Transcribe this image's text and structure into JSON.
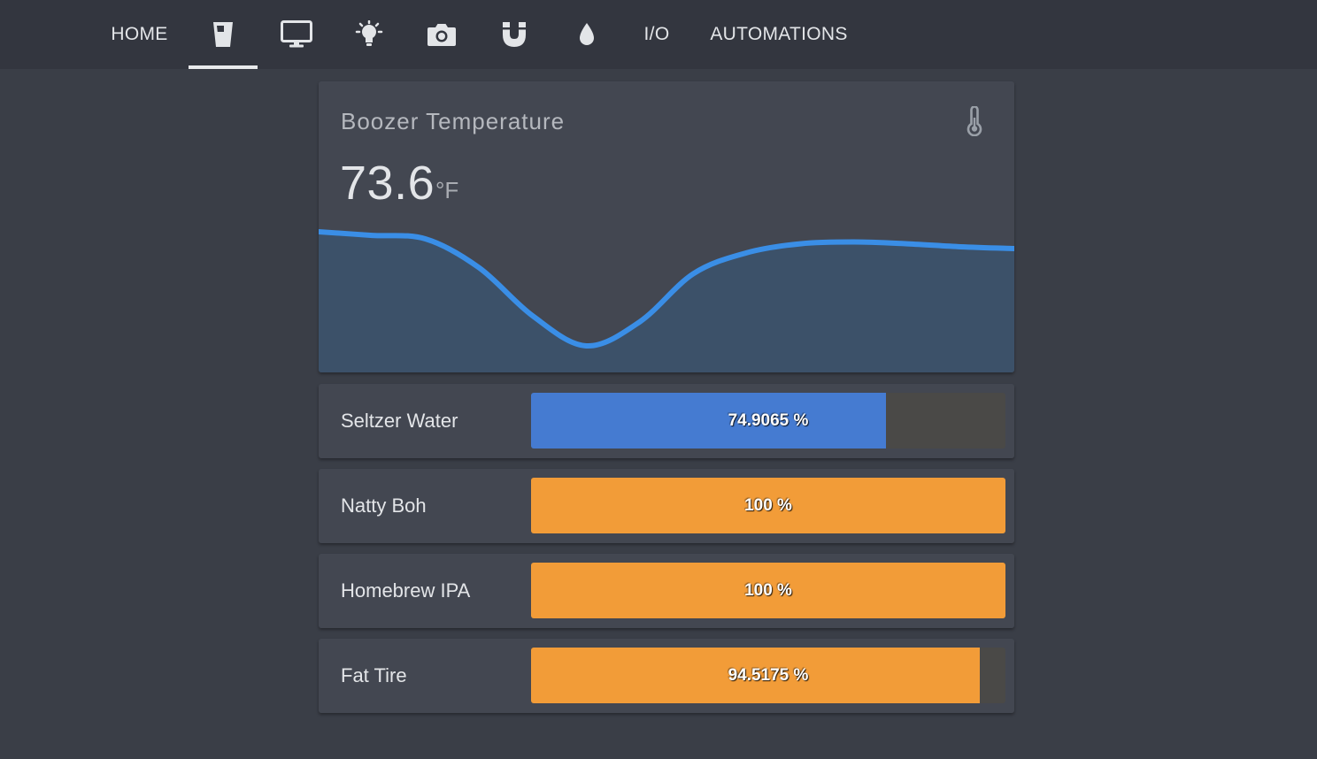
{
  "nav": {
    "tabs": [
      {
        "label": "HOME",
        "icon": null
      },
      {
        "label": "",
        "icon": "glass-icon",
        "active": true
      },
      {
        "label": "",
        "icon": "monitor-icon"
      },
      {
        "label": "",
        "icon": "lightbulb-icon"
      },
      {
        "label": "",
        "icon": "camera-icon"
      },
      {
        "label": "",
        "icon": "magnet-icon"
      },
      {
        "label": "",
        "icon": "water-drop-icon"
      },
      {
        "label": "I/O",
        "icon": null
      },
      {
        "label": "AUTOMATIONS",
        "icon": null
      }
    ]
  },
  "sensor": {
    "title": "Boozer Temperature",
    "value": "73.6",
    "unit": "°F",
    "icon": "thermometer-icon",
    "colors": {
      "line": "#3a8ee6",
      "fill": "#3c5169"
    },
    "chart_data": {
      "type": "area",
      "points": [
        73.8,
        73.74,
        73.68,
        73.2,
        72.4,
        71.9,
        72.3,
        73.1,
        73.45,
        73.6,
        73.63,
        73.6,
        73.55,
        73.52
      ]
    }
  },
  "levels": [
    {
      "name": "Seltzer Water",
      "value": 74.9065,
      "label": "74.9065 %",
      "color": "#457bd1"
    },
    {
      "name": "Natty Boh",
      "value": 100,
      "label": "100 %",
      "color": "#f29c38"
    },
    {
      "name": "Homebrew IPA",
      "value": 100,
      "label": "100 %",
      "color": "#f29c38"
    },
    {
      "name": "Fat Tire",
      "value": 94.5175,
      "label": "94.5175 %",
      "color": "#f29c38"
    }
  ]
}
